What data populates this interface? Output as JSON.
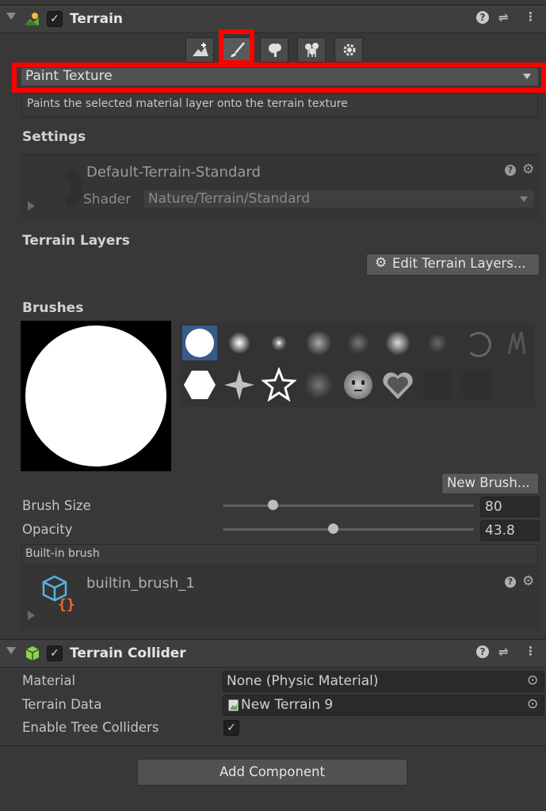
{
  "terrain_header": {
    "title": "Terrain",
    "enabled": true
  },
  "paint_mode": {
    "selected": "Paint Texture",
    "description": "Paints the selected material layer onto the terrain texture"
  },
  "settings": {
    "title": "Settings",
    "material_name": "Default-Terrain-Standard",
    "shader_label": "Shader",
    "shader_value": "Nature/Terrain/Standard"
  },
  "terrain_layers": {
    "title": "Terrain Layers",
    "edit_button": "Edit Terrain Layers..."
  },
  "brushes": {
    "title": "Brushes",
    "new_brush_button": "New Brush...",
    "brush_size_label": "Brush Size",
    "brush_size_value": "80",
    "brush_size_fraction": 0.2,
    "opacity_label": "Opacity",
    "opacity_value": "43.8",
    "opacity_fraction": 0.438,
    "brush_type_label": "Built-in brush",
    "brush_asset_name": "builtin_brush_1"
  },
  "collider": {
    "title": "Terrain Collider",
    "enabled": true,
    "material_label": "Material",
    "material_value": "None (Physic Material)",
    "terrain_data_label": "Terrain Data",
    "terrain_data_value": "New Terrain 9",
    "tree_colliders_label": "Enable Tree Colliders",
    "tree_colliders_checked": true
  },
  "add_component_button": "Add Component",
  "icons": {
    "help": "?",
    "settings": "⚙",
    "presets": "⇌",
    "more": "⋮",
    "check": "✓",
    "target": "⊙"
  },
  "colors": {
    "highlight": "#ff0000",
    "selected_brush": "#3a5a8c",
    "asset_icon": "#56b4e0",
    "asset_braces": "#f26a2b"
  }
}
